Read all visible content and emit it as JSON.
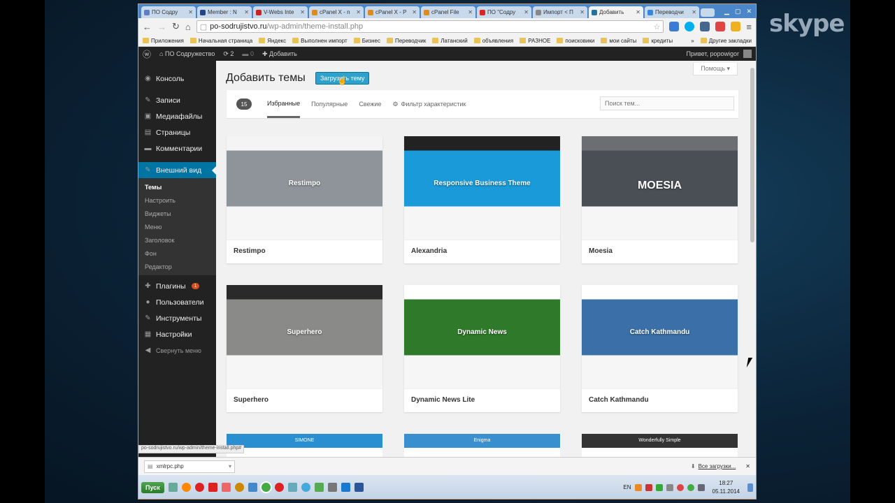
{
  "overlay": {
    "brand": "skype"
  },
  "browser": {
    "tabs": [
      {
        "label": "ПО Содру",
        "color": "#5a7fc4"
      },
      {
        "label": "Member : N",
        "color": "#224488"
      },
      {
        "label": "V-Webs Inte",
        "color": "#cc2222"
      },
      {
        "label": "cPanel X - n",
        "color": "#e08a1e"
      },
      {
        "label": "cPanel X - P",
        "color": "#e08a1e"
      },
      {
        "label": "cPanel File",
        "color": "#e08a1e"
      },
      {
        "label": "ПО \"Содру",
        "color": "#dd2222"
      },
      {
        "label": "Импорт < П",
        "color": "#888888"
      },
      {
        "label": "Добавить",
        "color": "#21759b",
        "active": true
      },
      {
        "label": "Переводчи",
        "color": "#3388dd"
      }
    ],
    "url_host": "po-sodrujistvo.ru",
    "url_path": "/wp-admin/theme-install.php",
    "bookmarks": [
      "Приложения",
      "Начальная страница",
      "Яндекс",
      "Выполнен импорт",
      "Бизнес",
      "Переводчик",
      "Латанский",
      "объявления",
      "РАЗНОЕ",
      "поисковики",
      "мои сайты",
      "кредиты"
    ],
    "bookmarks_more": "»",
    "other_bookmarks": "Другие закладки",
    "status_url": "po-sodrujistvo.ru/wp-admin/theme-install.php#"
  },
  "adminbar": {
    "site": "ПО Содружество",
    "updates": "2",
    "comments": "0",
    "add": "Добавить",
    "greeting": "Привет, popowigor"
  },
  "sidebar": {
    "items": [
      {
        "label": "Консоль",
        "icon": "◉"
      },
      {
        "label": "Записи",
        "icon": "✎"
      },
      {
        "label": "Медиафайлы",
        "icon": "▣"
      },
      {
        "label": "Страницы",
        "icon": "▤"
      },
      {
        "label": "Комментарии",
        "icon": "▬"
      }
    ],
    "active": {
      "label": "Внешний вид",
      "icon": "✎"
    },
    "submenu": [
      "Темы",
      "Настроить",
      "Виджеты",
      "Меню",
      "Заголовок",
      "Фон",
      "Редактор"
    ],
    "after": [
      {
        "label": "Плагины",
        "icon": "✚",
        "badge": "1"
      },
      {
        "label": "Пользователи",
        "icon": "●"
      },
      {
        "label": "Инструменты",
        "icon": "✎"
      },
      {
        "label": "Настройки",
        "icon": "▦"
      },
      {
        "label": "Свернуть меню",
        "icon": "◀"
      }
    ]
  },
  "page": {
    "help": "Помощь ▾",
    "title": "Добавить темы",
    "upload": "Загрузить тему",
    "count": "15",
    "filters": [
      "Избранные",
      "Популярные",
      "Свежие"
    ],
    "feature_filter": "Фильтр характеристик",
    "search_placeholder": "Поиск тем..."
  },
  "themes": [
    {
      "name": "Restimpo",
      "shot_top": "#f4f4f4",
      "shot_mid": "#8e9499",
      "shot_text": "Restimpo"
    },
    {
      "name": "Alexandria",
      "shot_top": "#222222",
      "shot_mid": "#1a9ad9",
      "shot_text": "Responsive Business Theme"
    },
    {
      "name": "Moesia",
      "shot_top": "#6b6f74",
      "shot_mid": "#4a4f55",
      "shot_text": "MOESIA"
    },
    {
      "name": "Superhero",
      "shot_top": "#2a2a2a",
      "shot_mid": "#8a8a88",
      "shot_text": "Superhero"
    },
    {
      "name": "Dynamic News Lite",
      "shot_top": "#ffffff",
      "shot_mid": "#2f7a2a",
      "shot_text": "Dynamic News"
    },
    {
      "name": "Catch Kathmandu",
      "shot_top": "#ffffff",
      "shot_mid": "#3a6fa8",
      "shot_text": "Catch Kathmandu"
    }
  ],
  "next_row": [
    {
      "color": "#2a8fd0",
      "text": "SIMONE"
    },
    {
      "color": "#3a8fce",
      "text": "Enigma"
    },
    {
      "color": "#333333",
      "text": "Wonderfully Simple"
    }
  ],
  "download": {
    "file": "xmlrpc.php",
    "all": "Все загрузки..."
  },
  "taskbar": {
    "start": "Пуск",
    "lang": "EN",
    "time": "18:27",
    "date": "05.11.2014"
  }
}
